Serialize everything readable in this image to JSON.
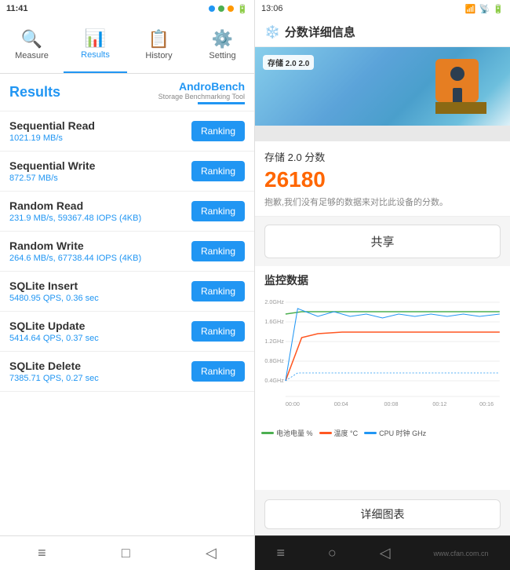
{
  "left": {
    "status_time": "11:41",
    "nav_tabs": [
      {
        "id": "measure",
        "label": "Measure",
        "icon": "🔍"
      },
      {
        "id": "results",
        "label": "Results",
        "icon": "📊",
        "active": true
      },
      {
        "id": "history",
        "label": "History",
        "icon": "📋"
      },
      {
        "id": "setting",
        "label": "Setting",
        "icon": "⚙️"
      }
    ],
    "results_title": "Results",
    "logo_name_part1": "Andro",
    "logo_name_part2": "Bench",
    "logo_sub": "Storage Benchmarking Tool",
    "benchmarks": [
      {
        "name": "Sequential Read",
        "value": "1021.19 MB/s",
        "btn_label": "Ranking"
      },
      {
        "name": "Sequential Write",
        "value": "872.57 MB/s",
        "btn_label": "Ranking"
      },
      {
        "name": "Random Read",
        "value": "231.9 MB/s, 59367.48 IOPS (4KB)",
        "btn_label": "Ranking"
      },
      {
        "name": "Random Write",
        "value": "264.6 MB/s, 67738.44 IOPS (4KB)",
        "btn_label": "Ranking"
      },
      {
        "name": "SQLite Insert",
        "value": "5480.95 QPS, 0.36 sec",
        "btn_label": "Ranking"
      },
      {
        "name": "SQLite Update",
        "value": "5414.64 QPS, 0.37 sec",
        "btn_label": "Ranking"
      },
      {
        "name": "SQLite Delete",
        "value": "7385.71 QPS, 0.27 sec",
        "btn_label": "Ranking"
      }
    ],
    "bottom_nav": [
      "≡",
      "□",
      "◁"
    ]
  },
  "right": {
    "status_time": "13:06",
    "detail_header": "分数详细信息",
    "banner_badge": "存储 2.0  2.0",
    "score_label": "存储 2.0 分数",
    "score_value": "26180",
    "score_note": "抱歉,我们没有足够的数据来对比此设备的分数。",
    "share_label": "共享",
    "monitor_title": "监控数据",
    "chart_times": [
      "00:00",
      "00:04",
      "00:08",
      "00:12",
      "00:16"
    ],
    "chart_y_labels": [
      "2.0GHz",
      "1.6GHz",
      "1.2GHz",
      "0.8GHz",
      "0.4GHz"
    ],
    "legend": [
      {
        "label": "电池电量 %",
        "color": "#4CAF50"
      },
      {
        "label": "温度 °C",
        "color": "#FF5722"
      },
      {
        "label": "CPU 时钟 GHz",
        "color": "#2196F3"
      }
    ],
    "detail_btn": "详细图表",
    "bottom_nav": [
      "≡",
      "○",
      "◁"
    ],
    "watermark": "www.cfan.com.cn"
  }
}
